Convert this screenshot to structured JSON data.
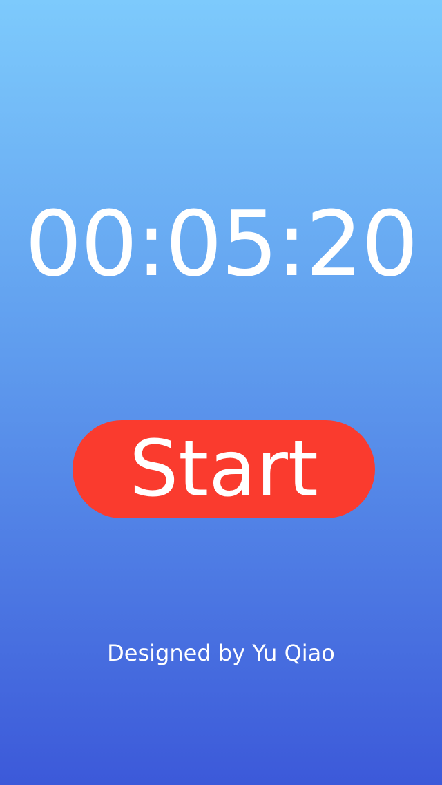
{
  "timer": {
    "display": "00:05:20"
  },
  "controls": {
    "start_label": "Start"
  },
  "footer": {
    "credit": "Designed by Yu Qiao"
  },
  "colors": {
    "background_top": "#7dcafc",
    "background_bottom": "#3c59d9",
    "start_button": "#fa3b2e",
    "text": "#ffffff"
  }
}
